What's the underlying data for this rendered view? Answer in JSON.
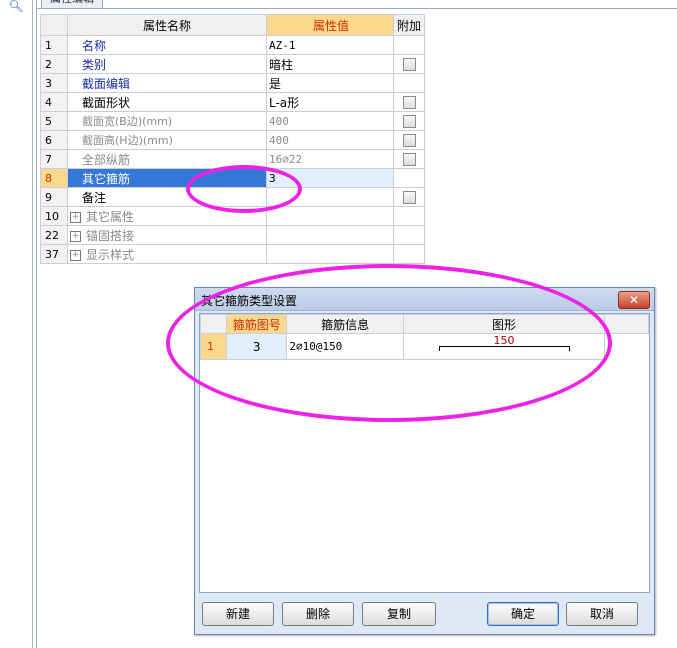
{
  "tab_label": "属性编辑",
  "property_grid": {
    "headers": {
      "name": "属性名称",
      "value": "属性值",
      "extra": "附加"
    },
    "rows": [
      {
        "idx": "1",
        "name": "名称",
        "value": "AZ-1"
      },
      {
        "idx": "2",
        "name": "类别",
        "value": "暗柱"
      },
      {
        "idx": "3",
        "name": "截面编辑",
        "value": "是"
      },
      {
        "idx": "4",
        "name": "截面形状",
        "value": "L-a形"
      },
      {
        "idx": "5",
        "name": "截面宽(B边)(mm)",
        "value": "400"
      },
      {
        "idx": "6",
        "name": "截面高(H边)(mm)",
        "value": "400"
      },
      {
        "idx": "7",
        "name": "全部纵筋",
        "value": "16⌀22"
      },
      {
        "idx": "8",
        "name": "其它箍筋",
        "value": "3"
      },
      {
        "idx": "9",
        "name": "备注",
        "value": ""
      },
      {
        "idx": "10",
        "name": "其它属性",
        "value": ""
      },
      {
        "idx": "22",
        "name": "锚固搭接",
        "value": ""
      },
      {
        "idx": "37",
        "name": "显示样式",
        "value": ""
      }
    ]
  },
  "dialog": {
    "title": "其它箍筋类型设置",
    "close_label": "✕",
    "headers": {
      "num": "箍筋图号",
      "info": "箍筋信息",
      "shape": "图形"
    },
    "rows": [
      {
        "idx": "1",
        "num": "3",
        "info": "2⌀10@150",
        "shape_label": "150"
      }
    ],
    "buttons": {
      "new": "新建",
      "delete": "删除",
      "copy": "复制",
      "ok": "确定",
      "cancel": "取消"
    }
  },
  "colors": {
    "highlight": "#ee22e6",
    "selection": "#3477d6",
    "header_accent": "#fcd88c"
  }
}
